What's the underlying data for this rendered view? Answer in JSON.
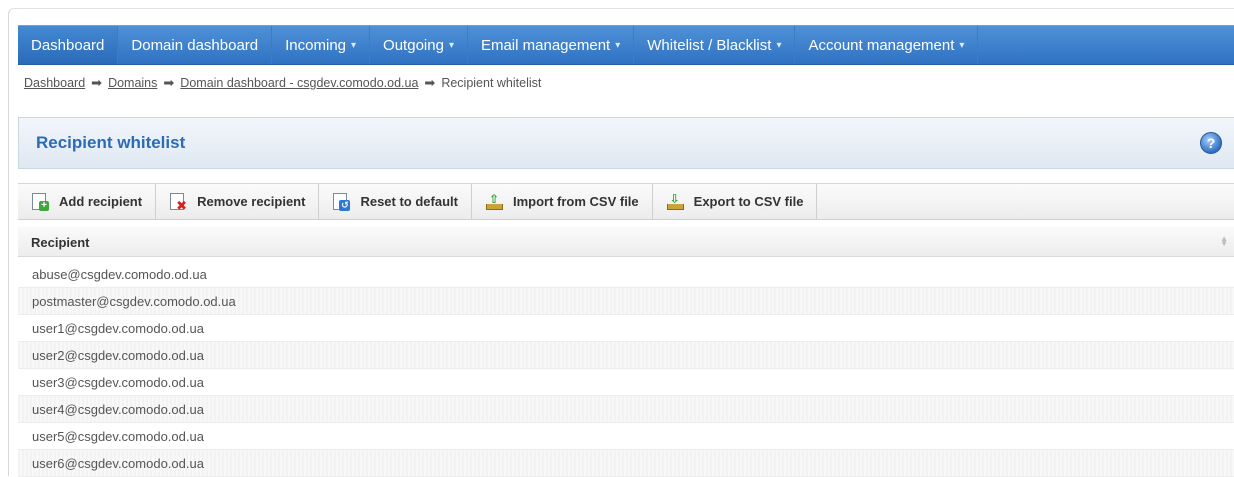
{
  "nav": {
    "items": [
      {
        "label": "Dashboard",
        "dropdown": false
      },
      {
        "label": "Domain dashboard",
        "dropdown": false
      },
      {
        "label": "Incoming",
        "dropdown": true
      },
      {
        "label": "Outgoing",
        "dropdown": true
      },
      {
        "label": "Email management",
        "dropdown": true
      },
      {
        "label": "Whitelist / Blacklist",
        "dropdown": true
      },
      {
        "label": "Account management",
        "dropdown": true
      }
    ],
    "caret": "▾"
  },
  "breadcrumb": {
    "items": [
      "Dashboard",
      "Domains",
      "Domain dashboard - csgdev.comodo.od.ua",
      "Recipient whitelist"
    ],
    "separator": "➡"
  },
  "panel": {
    "title": "Recipient whitelist",
    "help_icon": "?"
  },
  "toolbar": {
    "add_label": "Add recipient",
    "remove_label": "Remove recipient",
    "reset_label": "Reset to default",
    "import_label": "Import from CSV file",
    "export_label": "Export to CSV file"
  },
  "table": {
    "column_header": "Recipient",
    "rows": [
      "abuse@csgdev.comodo.od.ua",
      "postmaster@csgdev.comodo.od.ua",
      "user1@csgdev.comodo.od.ua",
      "user2@csgdev.comodo.od.ua",
      "user3@csgdev.comodo.od.ua",
      "user4@csgdev.comodo.od.ua",
      "user5@csgdev.comodo.od.ua",
      "user6@csgdev.comodo.od.ua"
    ]
  },
  "colors": {
    "nav_blue": "#3b7fcc",
    "title_blue": "#2c6bb5"
  }
}
